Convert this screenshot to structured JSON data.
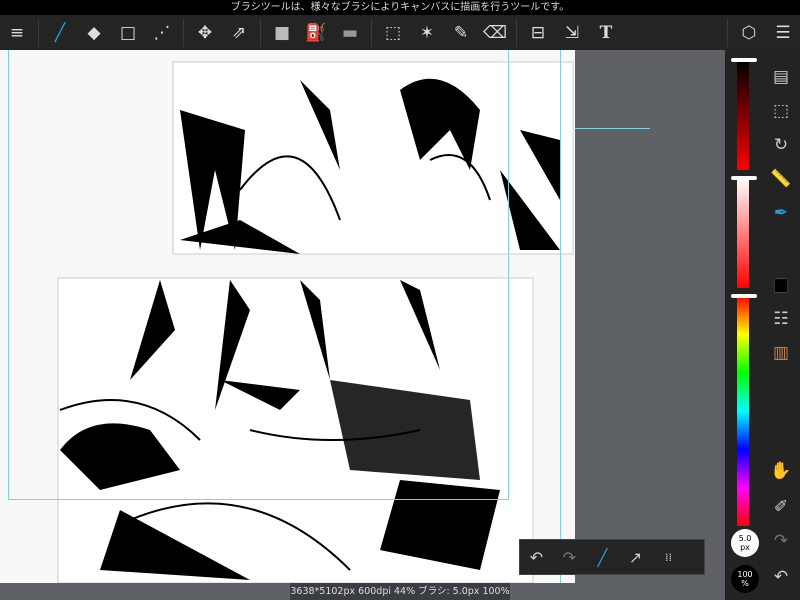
{
  "status_message": "ブラシツールは、様々なブラシによりキャンバスに描画を行うツールです。",
  "toolbar": {
    "tools": [
      {
        "name": "menu-icon",
        "glyph": "≡"
      },
      {
        "name": "brush-icon",
        "glyph": "╱",
        "active": true
      },
      {
        "name": "eraser-icon",
        "glyph": "◆"
      },
      {
        "name": "shape-icon",
        "glyph": "□"
      },
      {
        "name": "curve-icon",
        "glyph": "⋰"
      },
      {
        "name": "move-icon",
        "glyph": "✥"
      },
      {
        "name": "transform-icon",
        "glyph": "⇗"
      },
      {
        "name": "fill-color-icon",
        "glyph": "■"
      },
      {
        "name": "bucket-icon",
        "glyph": "⛽"
      },
      {
        "name": "gradient-icon",
        "glyph": "▬"
      },
      {
        "name": "select-icon",
        "glyph": "⬚"
      },
      {
        "name": "magic-wand-icon",
        "glyph": "✶"
      },
      {
        "name": "select-pen-icon",
        "glyph": "✎"
      },
      {
        "name": "select-eraser-icon",
        "glyph": "⌫"
      },
      {
        "name": "frame-divide-icon",
        "glyph": "⊟"
      },
      {
        "name": "operation-icon",
        "glyph": "⇲"
      },
      {
        "name": "text-icon",
        "glyph": "T"
      },
      {
        "name": "materials-icon",
        "glyph": "⬡"
      },
      {
        "name": "layers-icon",
        "glyph": "☰"
      }
    ]
  },
  "right_panel": {
    "icons": [
      {
        "name": "pages-icon",
        "glyph": "▤"
      },
      {
        "name": "selection-list-icon",
        "glyph": "⬚"
      },
      {
        "name": "rotate-icon",
        "glyph": "↻"
      },
      {
        "name": "ruler-icon",
        "glyph": "📏"
      },
      {
        "name": "pen-active-icon",
        "glyph": "✒"
      },
      {
        "name": "color-swatch-icon",
        "glyph": "■"
      },
      {
        "name": "palette-list-icon",
        "glyph": "☷"
      },
      {
        "name": "color-mixer-icon",
        "glyph": "▥"
      },
      {
        "name": "hand-icon",
        "glyph": "✋"
      },
      {
        "name": "eyedropper-icon",
        "glyph": "✐"
      },
      {
        "name": "redo-icon",
        "glyph": "↷"
      },
      {
        "name": "undo-icon",
        "glyph": "↶"
      }
    ],
    "brush_size": "5.0",
    "brush_size_unit": "px",
    "opacity": "100",
    "opacity_unit": "%",
    "brightness": 0.0,
    "saturation": 1.0,
    "hue": 0.0
  },
  "quickbar": {
    "icons": [
      {
        "name": "undo-icon",
        "glyph": "↶"
      },
      {
        "name": "redo-icon",
        "glyph": "↷"
      },
      {
        "name": "brush-eraser-toggle-icon",
        "glyph": "╱"
      },
      {
        "name": "snap-icon",
        "glyph": "↗"
      },
      {
        "name": "grid-icon",
        "glyph": "⁞⁞"
      }
    ]
  },
  "canvas_info": "3638*5102px 600dpi 44% ブラシ: 5.0px 100%",
  "colors": {
    "accent": "#2a9fd6",
    "toolbar": "#242424",
    "canvas_bg": "#5e6166"
  }
}
